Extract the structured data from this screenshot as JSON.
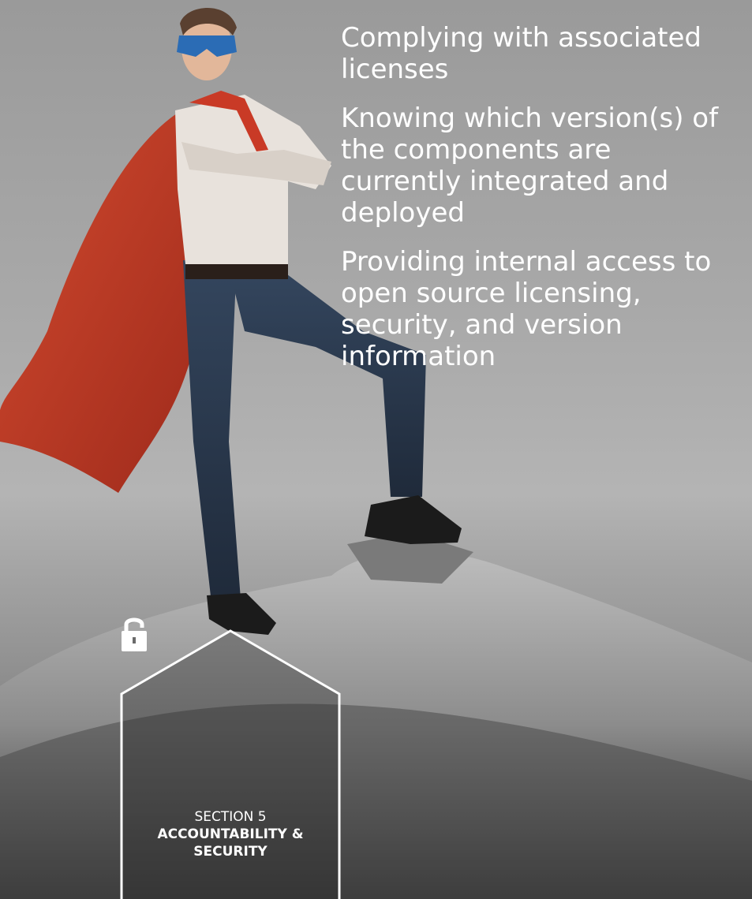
{
  "bullets": [
    "Complying with associated licenses",
    "Knowing which version(s) of the components are currently integrated and deployed",
    "Providing internal access to open source licensing, security, and version information"
  ],
  "badge": {
    "section_label": "SECTION 5",
    "title_line1": "ACCOUNTABILITY &",
    "title_line2": "SECURITY",
    "icon": "padlock-icon"
  },
  "colors": {
    "text": "#ffffff",
    "cape": "#c0392b",
    "mask": "#2b6cb5"
  }
}
